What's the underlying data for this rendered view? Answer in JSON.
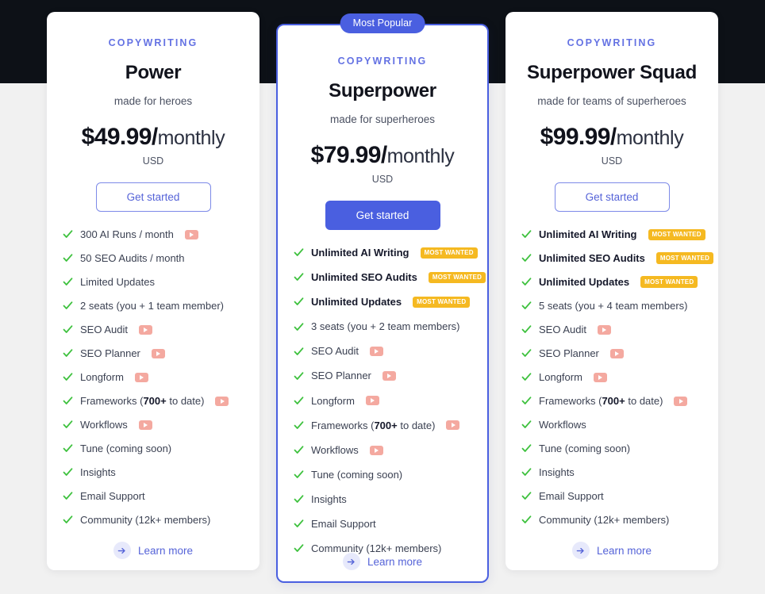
{
  "page": {
    "background_top": "#0d1117",
    "background": "#f1f1f1",
    "accent": "#4a5fe0",
    "eyebrow_color": "#6472e3",
    "badge_wanted_color": "#f5b921",
    "video_badge_color": "#f4a9a0",
    "check_color": "#3ec13e"
  },
  "plans": [
    {
      "featured": false,
      "popular_badge": "",
      "eyebrow": "COPYWRITING",
      "name": "Power",
      "tagline": "made for heroes",
      "price": "$49.99/",
      "period": "monthly",
      "currency": "USD",
      "cta": "Get started",
      "learn_more": "Learn more",
      "features": [
        {
          "text": "300 AI Runs / month",
          "bold": false,
          "video": true,
          "tag": ""
        },
        {
          "text": "50 SEO Audits / month",
          "bold": false,
          "video": false,
          "tag": ""
        },
        {
          "text": "Limited Updates",
          "bold": false,
          "video": false,
          "tag": ""
        },
        {
          "text": "2 seats (you + 1 team member)",
          "bold": false,
          "video": false,
          "tag": ""
        },
        {
          "text": "SEO Audit",
          "bold": false,
          "video": true,
          "tag": ""
        },
        {
          "text": "SEO Planner",
          "bold": false,
          "video": true,
          "tag": ""
        },
        {
          "text": "Longform",
          "bold": false,
          "video": true,
          "tag": ""
        },
        {
          "text": "Frameworks (700+ to date)",
          "bold": false,
          "video": true,
          "tag": "",
          "strong_part": "700+"
        },
        {
          "text": "Workflows",
          "bold": false,
          "video": true,
          "tag": ""
        },
        {
          "text": "Tune (coming soon)",
          "bold": false,
          "video": false,
          "tag": ""
        },
        {
          "text": "Insights",
          "bold": false,
          "video": false,
          "tag": ""
        },
        {
          "text": "Email Support",
          "bold": false,
          "video": false,
          "tag": ""
        },
        {
          "text": "Community (12k+ members)",
          "bold": false,
          "video": false,
          "tag": ""
        }
      ]
    },
    {
      "featured": true,
      "popular_badge": "Most Popular",
      "eyebrow": "COPYWRITING",
      "name": "Superpower",
      "tagline": "made for superheroes",
      "price": "$79.99/",
      "period": "monthly",
      "currency": "USD",
      "cta": "Get started",
      "learn_more": "Learn more",
      "features": [
        {
          "text": "Unlimited AI Writing",
          "bold": true,
          "video": false,
          "tag": "MOST WANTED"
        },
        {
          "text": "Unlimited SEO Audits",
          "bold": true,
          "video": false,
          "tag": "MOST WANTED"
        },
        {
          "text": "Unlimited Updates",
          "bold": true,
          "video": false,
          "tag": "MOST WANTED"
        },
        {
          "text": "3 seats (you + 2 team members)",
          "bold": false,
          "video": false,
          "tag": ""
        },
        {
          "text": "SEO Audit",
          "bold": false,
          "video": true,
          "tag": ""
        },
        {
          "text": "SEO Planner",
          "bold": false,
          "video": true,
          "tag": ""
        },
        {
          "text": "Longform",
          "bold": false,
          "video": true,
          "tag": ""
        },
        {
          "text": "Frameworks (700+ to date)",
          "bold": false,
          "video": true,
          "tag": "",
          "strong_part": "700+"
        },
        {
          "text": "Workflows",
          "bold": false,
          "video": true,
          "tag": ""
        },
        {
          "text": "Tune (coming soon)",
          "bold": false,
          "video": false,
          "tag": ""
        },
        {
          "text": "Insights",
          "bold": false,
          "video": false,
          "tag": ""
        },
        {
          "text": "Email Support",
          "bold": false,
          "video": false,
          "tag": ""
        },
        {
          "text": "Community (12k+ members)",
          "bold": false,
          "video": false,
          "tag": ""
        }
      ]
    },
    {
      "featured": false,
      "popular_badge": "",
      "eyebrow": "COPYWRITING",
      "name": "Superpower Squad",
      "tagline": "made for teams of superheroes",
      "price": "$99.99/",
      "period": "monthly",
      "currency": "USD",
      "cta": "Get started",
      "learn_more": "Learn more",
      "features": [
        {
          "text": "Unlimited AI Writing",
          "bold": true,
          "video": false,
          "tag": "MOST WANTED"
        },
        {
          "text": "Unlimited SEO Audits",
          "bold": true,
          "video": false,
          "tag": "MOST WANTED"
        },
        {
          "text": "Unlimited Updates",
          "bold": true,
          "video": false,
          "tag": "MOST WANTED"
        },
        {
          "text": "5 seats (you + 4 team members)",
          "bold": false,
          "video": false,
          "tag": ""
        },
        {
          "text": "SEO Audit",
          "bold": false,
          "video": true,
          "tag": ""
        },
        {
          "text": "SEO Planner",
          "bold": false,
          "video": true,
          "tag": ""
        },
        {
          "text": "Longform",
          "bold": false,
          "video": true,
          "tag": ""
        },
        {
          "text": "Frameworks (700+ to date)",
          "bold": false,
          "video": true,
          "tag": "",
          "strong_part": "700+"
        },
        {
          "text": "Workflows",
          "bold": false,
          "video": false,
          "tag": ""
        },
        {
          "text": "Tune (coming soon)",
          "bold": false,
          "video": false,
          "tag": ""
        },
        {
          "text": "Insights",
          "bold": false,
          "video": false,
          "tag": ""
        },
        {
          "text": "Email Support",
          "bold": false,
          "video": false,
          "tag": ""
        },
        {
          "text": "Community (12k+ members)",
          "bold": false,
          "video": false,
          "tag": ""
        }
      ]
    }
  ]
}
